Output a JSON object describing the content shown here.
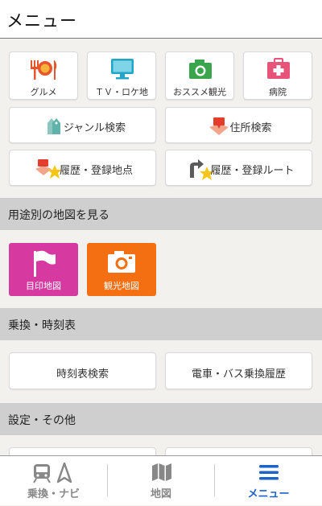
{
  "header": {
    "title": "メニュー"
  },
  "grid": [
    {
      "label": "グルメ",
      "icon": "gourmet-icon"
    },
    {
      "label": "ＴＶ・ロケ地",
      "icon": "tv-icon"
    },
    {
      "label": "おススメ観光",
      "icon": "camera-icon"
    },
    {
      "label": "病院",
      "icon": "hospital-icon"
    }
  ],
  "wide_buttons": [
    {
      "label": "ジャンル検索",
      "icon": "tag-icon"
    },
    {
      "label": "住所検索",
      "icon": "map-pin-icon"
    },
    {
      "label": "履歴・登録地点",
      "icon": "history-point-icon"
    },
    {
      "label": "履歴・登録ルート",
      "icon": "history-route-icon"
    }
  ],
  "sections": {
    "maps": "用途別の地図を見る",
    "transit": "乗換・時刻表",
    "settings": "設定・その他"
  },
  "map_tiles": [
    {
      "label": "目印地図",
      "color": "#d63aa0",
      "icon": "flag-icon"
    },
    {
      "label": "観光地図",
      "color": "#f36f12",
      "icon": "camera-icon"
    }
  ],
  "transit_buttons": [
    {
      "label": "時刻表検索"
    },
    {
      "label": "電車・バス乗換履歴"
    }
  ],
  "tabs": [
    {
      "label": "乗換・ナビ",
      "icon": "train-navi-icon",
      "active": false
    },
    {
      "label": "地図",
      "icon": "map-icon",
      "active": false
    },
    {
      "label": "メニュー",
      "icon": "menu-icon",
      "active": true
    }
  ],
  "colors": {
    "accent": "#1e63c8",
    "section_bg": "#cfcfcf",
    "page_bg": "#f2f1ee"
  }
}
